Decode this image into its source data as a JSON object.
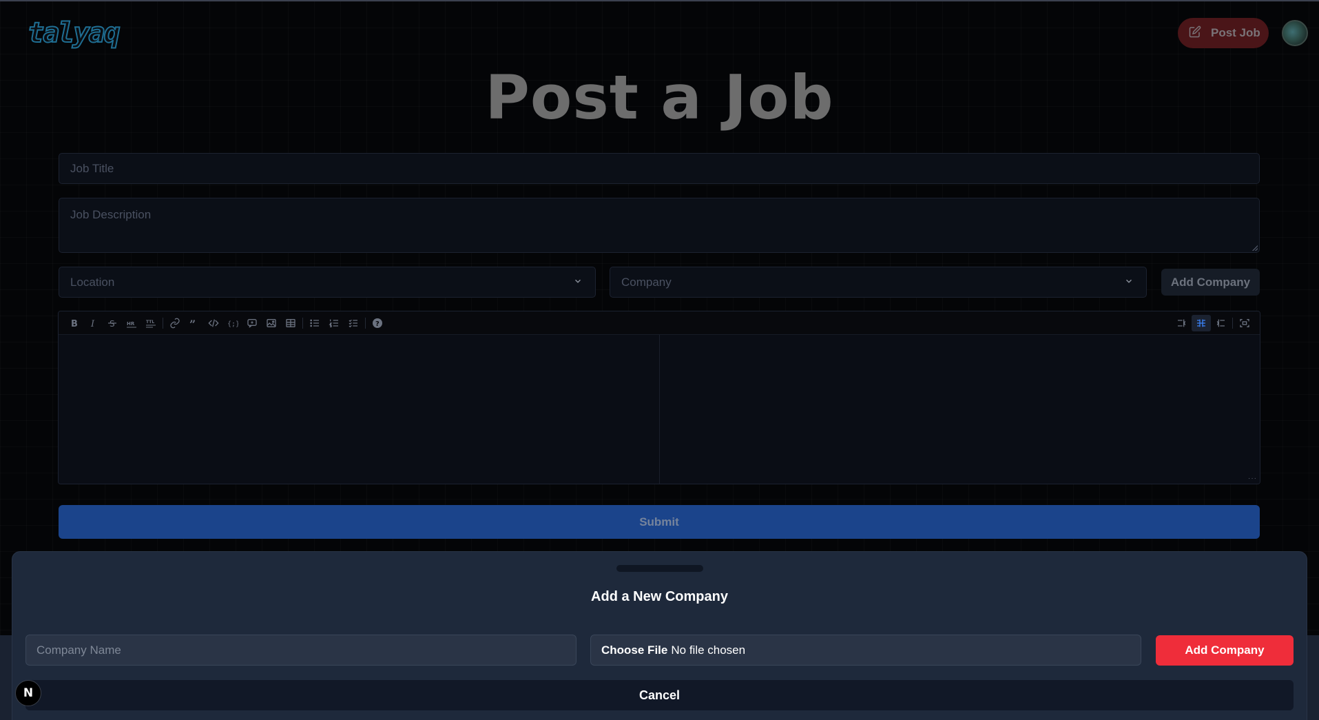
{
  "header": {
    "logo_text": "talyaq",
    "post_job_label": "Post Job"
  },
  "page": {
    "title": "Post a Job"
  },
  "form": {
    "job_title_placeholder": "Job Title",
    "job_description_placeholder": "Job Description",
    "location_placeholder": "Location",
    "company_placeholder": "Company",
    "add_company_label": "Add Company",
    "submit_label": "Submit"
  },
  "editor": {
    "toolbar_left": [
      "bold-icon",
      "italic-icon",
      "strikethrough-icon",
      "hr-icon",
      "title-icon",
      "link-icon",
      "quote-icon",
      "code-icon",
      "code-block-icon",
      "comment-icon",
      "image-icon",
      "table-icon",
      "unordered-list-icon",
      "ordered-list-icon",
      "checked-list-icon",
      "help-icon"
    ],
    "toolbar_right": [
      "edit-mode-icon",
      "live-mode-icon",
      "preview-mode-icon",
      "fullscreen-icon"
    ],
    "active_mode": "live-mode-icon"
  },
  "modal": {
    "title": "Add a New Company",
    "company_name_placeholder": "Company Name",
    "file_button_label": "Choose File",
    "file_status": "No file chosen",
    "add_company_label": "Add Company",
    "cancel_label": "Cancel"
  },
  "badge": {
    "label": "N"
  },
  "colors": {
    "background": "#040507",
    "submit": "#1b448b",
    "add_company_accent": "#ef2d3a",
    "modal": "#1e293b",
    "post_job_button": "#4a1518"
  }
}
